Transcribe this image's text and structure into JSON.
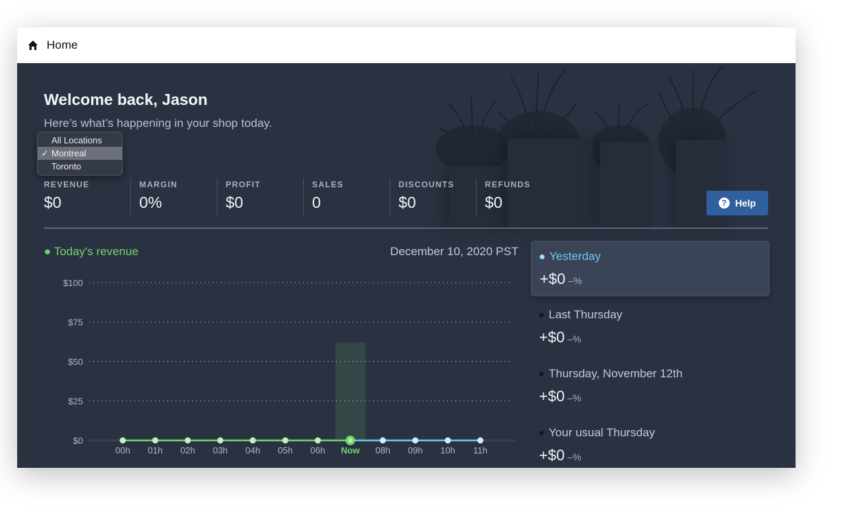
{
  "topbar": {
    "title": "Home",
    "icon": "home-icon"
  },
  "header": {
    "title": "Welcome back, Jason",
    "subtitle": "Here’s what’s happening in your shop today."
  },
  "location_dropdown": {
    "options": [
      "All Locations",
      "Montreal",
      "Toronto"
    ],
    "selected": "Montreal",
    "check": "✓"
  },
  "stats": [
    {
      "label": "REVENUE",
      "value": "$0"
    },
    {
      "label": "MARGIN",
      "value": "0%"
    },
    {
      "label": "PROFIT",
      "value": "$0"
    },
    {
      "label": "SALES",
      "value": "0"
    },
    {
      "label": "DISCOUNTS",
      "value": "$0"
    },
    {
      "label": "REFUNDS",
      "value": "$0"
    }
  ],
  "help_button": {
    "label": "Help",
    "icon": "question-circle-icon"
  },
  "revenue": {
    "title": "Today's revenue",
    "date": "December 10, 2020 PST"
  },
  "comparisons": [
    {
      "name": "Yesterday",
      "amount": "+$0",
      "percent": "–%",
      "active": true
    },
    {
      "name": "Last Thursday",
      "amount": "+$0",
      "percent": "–%"
    },
    {
      "name": "Thursday, November 12th",
      "amount": "+$0",
      "percent": "–%"
    },
    {
      "name": "Your usual Thursday",
      "amount": "+$0",
      "percent": "–%"
    }
  ],
  "colors": {
    "today": "#6fd46a",
    "comparison": "#6cc7f2",
    "background": "#2a3241",
    "help": "#2f5f9e"
  },
  "chart_data": {
    "type": "line",
    "categories": [
      "00h",
      "01h",
      "02h",
      "03h",
      "04h",
      "05h",
      "06h",
      "Now",
      "08h",
      "09h",
      "10h",
      "11h"
    ],
    "y_ticks": [
      "$0",
      "$25",
      "$50",
      "$75",
      "$100"
    ],
    "ylim": [
      0,
      100
    ],
    "grid": true,
    "current_index": 7,
    "series": [
      {
        "name": "Today's revenue",
        "values": [
          0,
          0,
          0,
          0,
          0,
          0,
          0,
          0
        ],
        "color": "#6fd46a"
      },
      {
        "name": "Yesterday",
        "values": [
          0,
          0,
          0,
          0,
          0,
          0,
          0,
          0,
          0,
          0,
          0,
          0
        ],
        "color": "#6cc7f2"
      }
    ]
  }
}
